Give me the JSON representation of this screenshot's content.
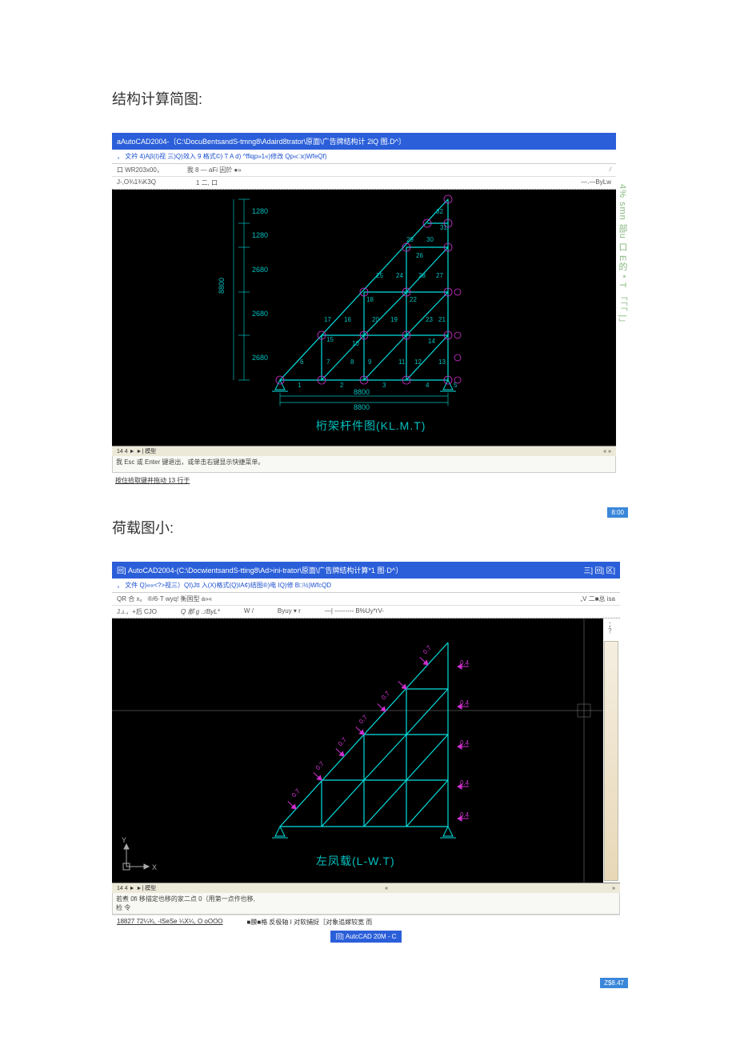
{
  "section1_title": "结构计算简图:",
  "section2_title": "荷载图小:",
  "side_text": "4% smn 部u 口 E的 * T 「「「 |」",
  "time_badge1": "8:00",
  "time_badge2": "Z$8.47",
  "cad1": {
    "title": "aAutoCAD2004-〔C:\\DocuBentsandS-tmng8\\Adaird8trator\\原面\\广告牌结构计 2lQ 图.D^〕",
    "menu_items": "， 文衿 4)Aβ(I)视 三)Q)效入 9 格式©) T A d) ^ffiqp»1«)修改 Qp«□x)WfeQf)",
    "toolbar": {
      "a": "口 WR203x00，",
      "b": "我 8 — aFi 因於 ●»",
      "c": "/"
    },
    "layer": {
      "a": "J-,O¾1¾K3Q",
      "b": "1 二, 口",
      "c": "—.—ByLw"
    },
    "cmd_hint": "我 Esc 或 Enter 键退出，或单击右键显示快捷菜单。",
    "footer": "按住拾取键并拖动 13 行于",
    "tabs": "14  4  ► ►| 模型",
    "drawing": {
      "caption": "桁架杆件图(KL.M.T)",
      "dim_v": [
        "1280",
        "1280",
        "2680",
        "8800",
        "2680",
        "2680"
      ],
      "dim_h": [
        "8800",
        "8800"
      ],
      "nodes": [
        "1",
        "2",
        "3",
        "4",
        "5",
        "6",
        "7",
        "8",
        "9",
        "10",
        "11",
        "12",
        "13",
        "14",
        "15",
        "16",
        "17",
        "18",
        "19",
        "20",
        "21",
        "22",
        "23",
        "24",
        "25",
        "26",
        "27",
        "28",
        "29",
        "30",
        "31",
        "32"
      ]
    },
    "arrows": "«    »"
  },
  "cad2": {
    "title_prefix": "回]",
    "title": "AutoCAD2004-(C:\\DocwientsandS-tting8\\Ad>ini-trator\\原面\\广告牌结构计算*1 图·D^〕",
    "win_buttons": "三]  回]  区]",
    "menu_items": "， 文件 Q)««<?>视三）QI)Jtt 入(X)格式(Q)IA¢)结图®)电 IQ)修 B□½)WfcQD",
    "toolbar_row1": "QR 合 x。 ®/6·T   wyq! 衡国型 a»«",
    "toolbar_row1_right": "„V 二■总 isa",
    "layer": {
      "a": "J.ɹ.，+后 CJO",
      "b": "Q 部 g  .:/ByL*",
      "c": "W /",
      "d": "Byuy ▾ r",
      "e": "—| --------- B%Uy*rV-"
    },
    "sidebar_marker": "；？",
    "cmd_hint": "若煮 0fi 移描定也移的家二点 0（用第一点作也移,",
    "cmd_line2": "检 令",
    "status_left": "18827 72¼¾, -ISeSe ¼X¼, O oOOO",
    "status_right": "■膜■格 反极轴 I 对软捕捉［对象追嫁较宽 而",
    "task_button": "回] AutcCAD 20M - C",
    "tabs": "14  4  ► ►| 模型",
    "arrows": "«    »",
    "drawing": {
      "caption": "左凤载(L-W.T)",
      "loads": [
        "0.7",
        "0.7",
        "0.7",
        "0.7",
        "0.7",
        "0.7",
        "0.4",
        "0.4",
        "0.4",
        "0.4",
        "0.4"
      ]
    }
  }
}
